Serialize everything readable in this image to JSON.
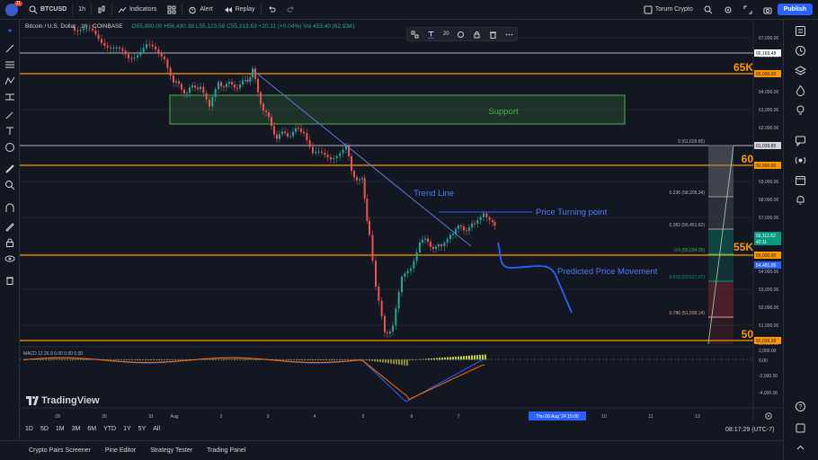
{
  "topbar": {
    "notif_count": "11",
    "symbol": "BTCUSD",
    "interval": "1h",
    "indicators": "Indicators",
    "alert": "Alert",
    "replay": "Replay",
    "layout_name": "Torum Crypto",
    "publish": "Publish"
  },
  "legend": {
    "title": "Bitcoin / U.S. Dollar · 1h · COINBASE",
    "values": "O55,890.00 H56,430.38 L55,123.56 C55,313.63 +20.11 (+0.04%) Vol 453.40 (62.93K)"
  },
  "drawing_toolbar": {
    "line_width": "20"
  },
  "price_axis": {
    "labels": [
      "67,000.00",
      "66,000.00",
      "65,000.00",
      "64,000.00",
      "63,000.00",
      "62,000.00",
      "61,000.00",
      "60,000.00",
      "59,000.00",
      "58,000.00",
      "57,000.00",
      "56,000.00",
      "55,000.00",
      "54,000.00",
      "53,000.00",
      "52,000.00",
      "51,000.00",
      "50,000.00"
    ],
    "tags": [
      {
        "text": "66,169.48",
        "color": "#d1d4dc",
        "bg": "#ffffff",
        "fg": "#131722"
      },
      {
        "text": "65,000.00",
        "bg": "#ff9800",
        "fg": "#131722"
      },
      {
        "text": "61,039.85",
        "bg": "#d1d4dc",
        "fg": "#131722"
      },
      {
        "text": "60,000.00",
        "bg": "#ff9800",
        "fg": "#131722"
      },
      {
        "text": "56,112.62",
        "bg": "#089981",
        "fg": "#ffffff"
      },
      {
        "text": "42:11",
        "bg": "#089981",
        "fg": "#ffffff"
      },
      {
        "text": "55,000.00",
        "bg": "#ff9800",
        "fg": "#131722"
      },
      {
        "text": "54,481.00",
        "bg": "#2962ff",
        "fg": "#ffffff"
      },
      {
        "text": "50,039.38",
        "bg": "#ff9800",
        "fg": "#131722"
      }
    ]
  },
  "levels": {
    "k65": "65K",
    "k60": "60",
    "k55": "55K",
    "k50": "50"
  },
  "annotations": {
    "support": "Support",
    "trend_line": "Trend Line",
    "price_turning_point": "Price Turning point",
    "predicted_movement": "Predicted Price Movement"
  },
  "fib": {
    "levels": [
      {
        "label": "0 (61,039.85)"
      },
      {
        "label": "0.236 (58,205.34)"
      },
      {
        "label": "0.382 (56,451.62)"
      },
      {
        "label": "0.5 (55,034.35)"
      },
      {
        "label": "0.618 (53,617.07)"
      },
      {
        "label": "0.786 (51,599.14)"
      }
    ]
  },
  "macd": {
    "legend": "MACD 12 26 9  0.00  0.00  0.00",
    "axis": [
      "2,000.00",
      "0.00",
      "-2,000.00",
      "-4,000.00"
    ]
  },
  "time_axis": {
    "labels": [
      "29",
      "30",
      "31",
      "Aug",
      "2",
      "3",
      "4",
      "5",
      "6",
      "7",
      "8",
      "9",
      "10",
      "11",
      "12"
    ],
    "crosshair": "Thu 08 Aug '24   15:00"
  },
  "ranges": [
    "1D",
    "5D",
    "1M",
    "3M",
    "6M",
    "YTD",
    "1Y",
    "5Y",
    "All"
  ],
  "clock": "08:17:29 (UTC-7)",
  "brand": "TradingView",
  "bottombar": [
    "Crypto Pairs Screener",
    "Pine Editor",
    "Strategy Tester",
    "Trading Panel"
  ],
  "colors": {
    "bg": "#131722",
    "orange": "#ff9800",
    "blue": "#2962ff",
    "green": "#089981",
    "red": "#f23645",
    "support": "#4caf50"
  }
}
